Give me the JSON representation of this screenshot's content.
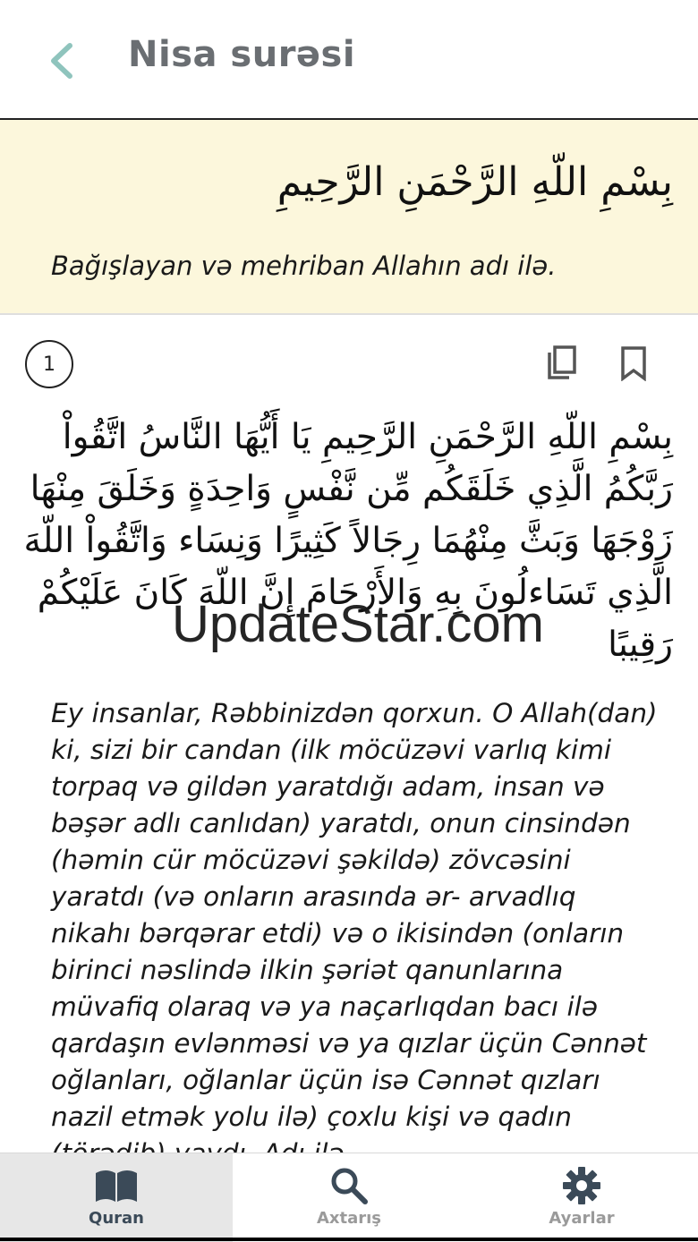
{
  "header": {
    "title": "Nisa surəsi",
    "back_icon": "chevron-left-icon",
    "accent_color": "#8fc4bd"
  },
  "bismillah": {
    "arabic": "بِسْمِ اللّهِ الرَّحْمَنِ الرَّحِيمِ",
    "translation": "Bağışlayan və mehriban Allahın adı ilə.",
    "background_color": "#fcf7dc"
  },
  "verse": {
    "number": "1",
    "arabic": "بِسْمِ اللّهِ الرَّحْمَنِ الرَّحِيمِ يَا أَيُّهَا النَّاسُ اتَّقُواْ رَبَّكُمُ الَّذِي خَلَقَكُم مِّن نَّفْسٍ وَاحِدَةٍ وَخَلَقَ مِنْهَا زَوْجَهَا وَبَثَّ مِنْهُمَا رِجَالاً كَثِيرًا وَنِسَاء وَاتَّقُواْ اللّهَ الَّذِي تَسَاءلُونَ بِهِ وَالأَرْحَامَ إِنَّ اللّهَ كَانَ عَلَيْكُمْ رَقِيبًا",
    "translation": "Ey insanlar, Rəbbinizdən qorxun. O Allah(dan) ki, sizi bir candan (ilk möcüzəvi varlıq kimi torpaq və gildən yaratdığı adam, insan və bəşər adlı canlıdan) yaratdı, onun cinsindən (həmin cür möcüzəvi şəkildə) zövcəsini yaratdı (və onların arasında ər- arvadlıq nikahı bərqərar etdi) və o ikisindən (onların birinci nəslində ilkin şəriət qanunlarına müvafiq olaraq və ya naçarlıqdan bacı ilə qardaşın evlənməsi və ya qızlar üçün Cənnət oğlanları, oğlanlar üçün isə Cənnət qızları nazil etmək yolu ilə) çoxlu kişi və qadın (törədib) yaydı. Adı ilə",
    "copy_icon": "copy-icon",
    "bookmark_icon": "bookmark-icon"
  },
  "watermark": {
    "text": "UpdateStar.com"
  },
  "bottom_nav": {
    "items": [
      {
        "label": "Quran",
        "icon": "book-icon",
        "active": true
      },
      {
        "label": "Axtarış",
        "icon": "search-icon",
        "active": false
      },
      {
        "label": "Ayarlar",
        "icon": "gear-icon",
        "active": false
      }
    ],
    "active_color": "#3b4a58",
    "inactive_color": "#9a9a9a"
  }
}
